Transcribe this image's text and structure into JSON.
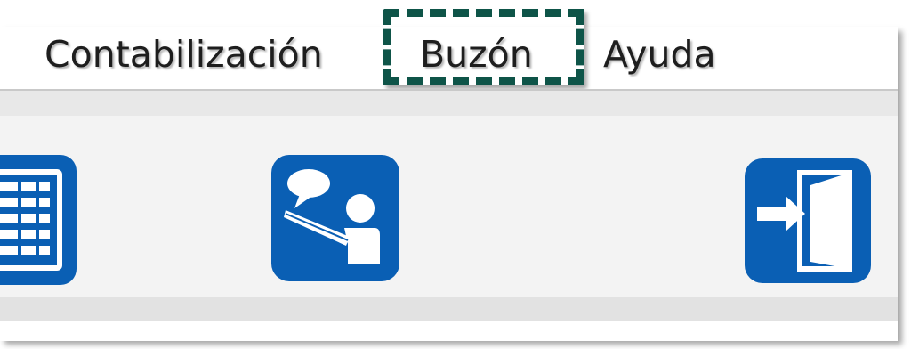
{
  "menu": {
    "items": [
      {
        "label": "Contabilización"
      },
      {
        "label": "Buzón",
        "highlighted": true
      },
      {
        "label": "Ayuda"
      }
    ]
  },
  "toolbar": {
    "buttons": [
      {
        "icon": "document-list-icon",
        "partially_visible": true
      },
      {
        "icon": "messaging-icon"
      },
      {
        "icon": "exit-door-icon"
      }
    ]
  },
  "colors": {
    "icon_blue": "#0a5fb4",
    "highlight": "#0e5448",
    "menu_text": "#1e1e1e"
  }
}
